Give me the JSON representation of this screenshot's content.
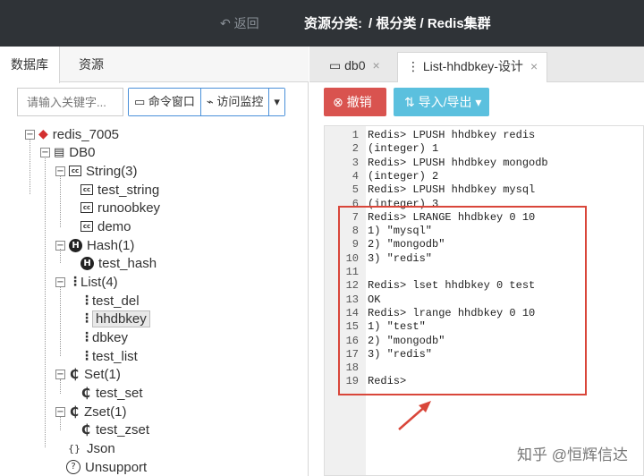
{
  "topbar": {
    "back_label": "返回",
    "resource_label": "资源分类:",
    "breadcrumb": "/ 根分类 / Redis集群"
  },
  "left": {
    "tabs": [
      "数据库",
      "资源"
    ],
    "search_placeholder": "请输入关键字...",
    "buttons": {
      "command_window": "命令窗口",
      "monitor": "访问监控"
    }
  },
  "tree": {
    "server": "redis_7005",
    "db": "DB0",
    "string_group": "String(3)",
    "string_items": [
      "test_string",
      "runoobkey",
      "demo"
    ],
    "hash_group": "Hash(1)",
    "hash_items": [
      "test_hash"
    ],
    "list_group": "List(4)",
    "list_items": [
      "test_del",
      "hhdbkey",
      "dbkey",
      "test_list"
    ],
    "set_group": "Set(1)",
    "set_items": [
      "test_set"
    ],
    "zset_group": "Zset(1)",
    "zset_items": [
      "test_zset"
    ],
    "json": "Json",
    "unsupport": "Unsupport"
  },
  "right": {
    "tabs": [
      "db0",
      "List-hhdbkey-设计"
    ],
    "undo_label": "撤销",
    "import_export_label": "导入/导出"
  },
  "console": {
    "lines": [
      "Redis> LPUSH hhdbkey redis",
      "(integer) 1",
      "Redis> LPUSH hhdbkey mongodb",
      "(integer) 2",
      "Redis> LPUSH hhdbkey mysql",
      "(integer) 3",
      "Redis> LRANGE hhdbkey 0 10",
      "1) \"mysql\"",
      "2) \"mongodb\"",
      "3) \"redis\"",
      "",
      "Redis> lset hhdbkey 0 test",
      "OK",
      "Redis> lrange hhdbkey 0 10",
      "1) \"test\"",
      "2) \"mongodb\"",
      "3) \"redis\"",
      "",
      "Redis>"
    ]
  },
  "watermark": "知乎 @恒辉信达",
  "colors": {
    "topbar": "#2f3337",
    "undo": "#d9534f",
    "import": "#5bc0de",
    "highlight_box": "#d9463a"
  }
}
